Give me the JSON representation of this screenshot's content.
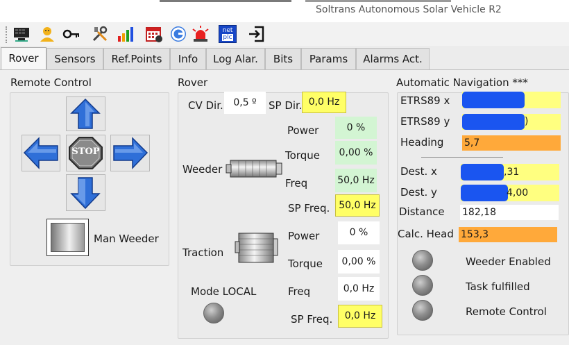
{
  "window": {
    "title": "Soltrans Autonomous Solar Vehicle R2"
  },
  "toolbar": {
    "icons": [
      "display-icon",
      "user-icon",
      "key-icon",
      "tools-icon",
      "bar-chart-icon",
      "calendar-icon",
      "refresh-icon",
      "alarm-siren-icon",
      "netplc-icon",
      "exit-icon"
    ],
    "netplc_top": "net",
    "netplc_bottom": "plc"
  },
  "tabs": [
    {
      "label": "Rover",
      "active": true
    },
    {
      "label": "Sensors",
      "active": false
    },
    {
      "label": "Ref.Points",
      "active": false
    },
    {
      "label": "Info",
      "active": false
    },
    {
      "label": "Log Alar.",
      "active": false
    },
    {
      "label": "Bits",
      "active": false
    },
    {
      "label": "Params",
      "active": false
    },
    {
      "label": "Alarms Act.",
      "active": false
    }
  ],
  "remote_control": {
    "title": "Remote Control",
    "stop_label": "STOP",
    "man_weeder_label": "Man Weeder"
  },
  "rover": {
    "title": "Rover",
    "cv_dir_label": "CV Dir.",
    "cv_dir_value": "0,5 º",
    "sp_dir_label": "SP Dir.",
    "sp_dir_value": "0,0 Hz",
    "weeder": {
      "label": "Weeder",
      "power_label": "Power",
      "power_value": "0 %",
      "torque_label": "Torque",
      "torque_value": "0,00 %",
      "freq_label": "Freq",
      "freq_value": "50,0 Hz",
      "sp_freq_label": "SP Freq.",
      "sp_freq_value": "50,0 Hz"
    },
    "traction": {
      "label": "Traction",
      "power_label": "Power",
      "power_value": "0 %",
      "torque_label": "Torque",
      "torque_value": "0,00 %",
      "freq_label": "Freq",
      "freq_value": "0,0 Hz",
      "sp_freq_label": "SP Freq.",
      "sp_freq_value": "0,0 Hz"
    },
    "mode_label": "Mode LOCAL"
  },
  "navigation": {
    "title": "Automatic Navigation ***",
    "etrs_x_label": "ETRS89 x",
    "etrs_y_label": "ETRS89 y",
    "etrs_y_suffix": ")",
    "heading_label": "Heading",
    "heading_value": "5,7",
    "dest_x_label": "Dest. x",
    "dest_x_value": ",31",
    "dest_y_label": "Dest. y",
    "dest_y_value": "4,00",
    "distance_label": "Distance",
    "distance_value": "182,18",
    "calc_head_label": "Calc. Head",
    "calc_head_value": "153,3",
    "indicators": [
      {
        "label": "Weeder Enabled"
      },
      {
        "label": "Task fulfilled"
      },
      {
        "label": "Remote Control"
      }
    ]
  },
  "colors": {
    "field_yellow": "#ffff66",
    "field_green": "#d3f5d3",
    "field_orange": "#ffa93a",
    "arrow_blue": "#2f6fd8"
  }
}
